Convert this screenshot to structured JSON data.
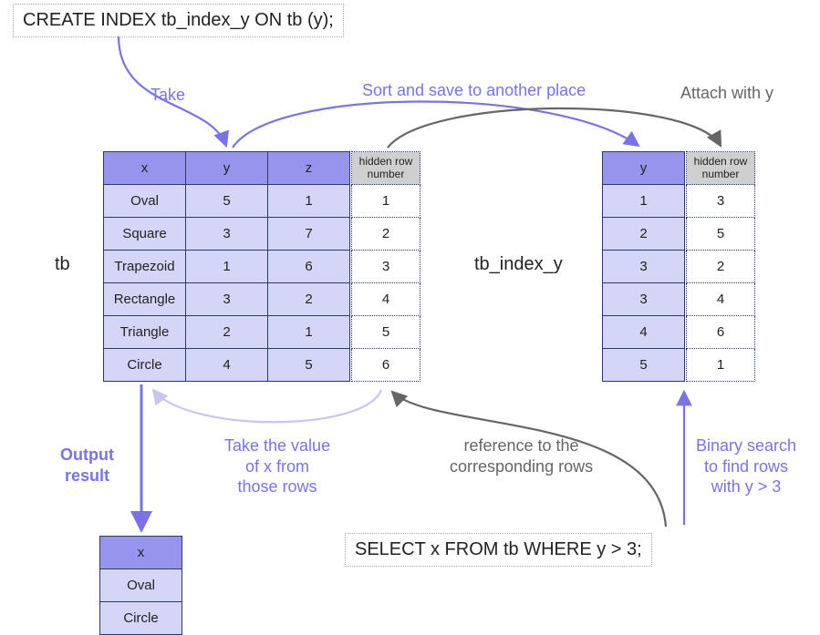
{
  "sql1": "CREATE INDEX tb_index_y ON tb (y);",
  "sql2": "SELECT x FROM tb WHERE y > 3;",
  "labels": {
    "take": "Take",
    "sort_save": "Sort and save to another place",
    "attach": "Attach with y",
    "tb": "tb",
    "tb_index_y": "tb_index_y",
    "output_result_1": "Output",
    "output_result_2": "result",
    "take_x_1": "Take the value",
    "take_x_2": "of x from",
    "take_x_3": "those rows",
    "reference_1": "reference to the",
    "reference_2": "corresponding rows",
    "binary_1": "Binary search",
    "binary_2": "to find rows",
    "binary_3": "with y > 3"
  },
  "tb_table": {
    "headers": {
      "x": "x",
      "y": "y",
      "z": "z",
      "hidden": "hidden row\nnumber"
    },
    "rows": [
      {
        "x": "Oval",
        "y": "5",
        "z": "1",
        "h": "1"
      },
      {
        "x": "Square",
        "y": "3",
        "z": "7",
        "h": "2"
      },
      {
        "x": "Trapezoid",
        "y": "1",
        "z": "6",
        "h": "3"
      },
      {
        "x": "Rectangle",
        "y": "3",
        "z": "2",
        "h": "4"
      },
      {
        "x": "Triangle",
        "y": "2",
        "z": "1",
        "h": "5"
      },
      {
        "x": "Circle",
        "y": "4",
        "z": "5",
        "h": "6"
      }
    ]
  },
  "index_table": {
    "headers": {
      "y": "y",
      "hidden": "hidden row\nnumber"
    },
    "rows": [
      {
        "y": "1",
        "h": "3"
      },
      {
        "y": "2",
        "h": "5"
      },
      {
        "y": "3",
        "h": "2"
      },
      {
        "y": "3",
        "h": "4"
      },
      {
        "y": "4",
        "h": "6"
      },
      {
        "y": "5",
        "h": "1"
      }
    ]
  },
  "result_table": {
    "header": "x",
    "rows": [
      "Oval",
      "Circle"
    ]
  }
}
